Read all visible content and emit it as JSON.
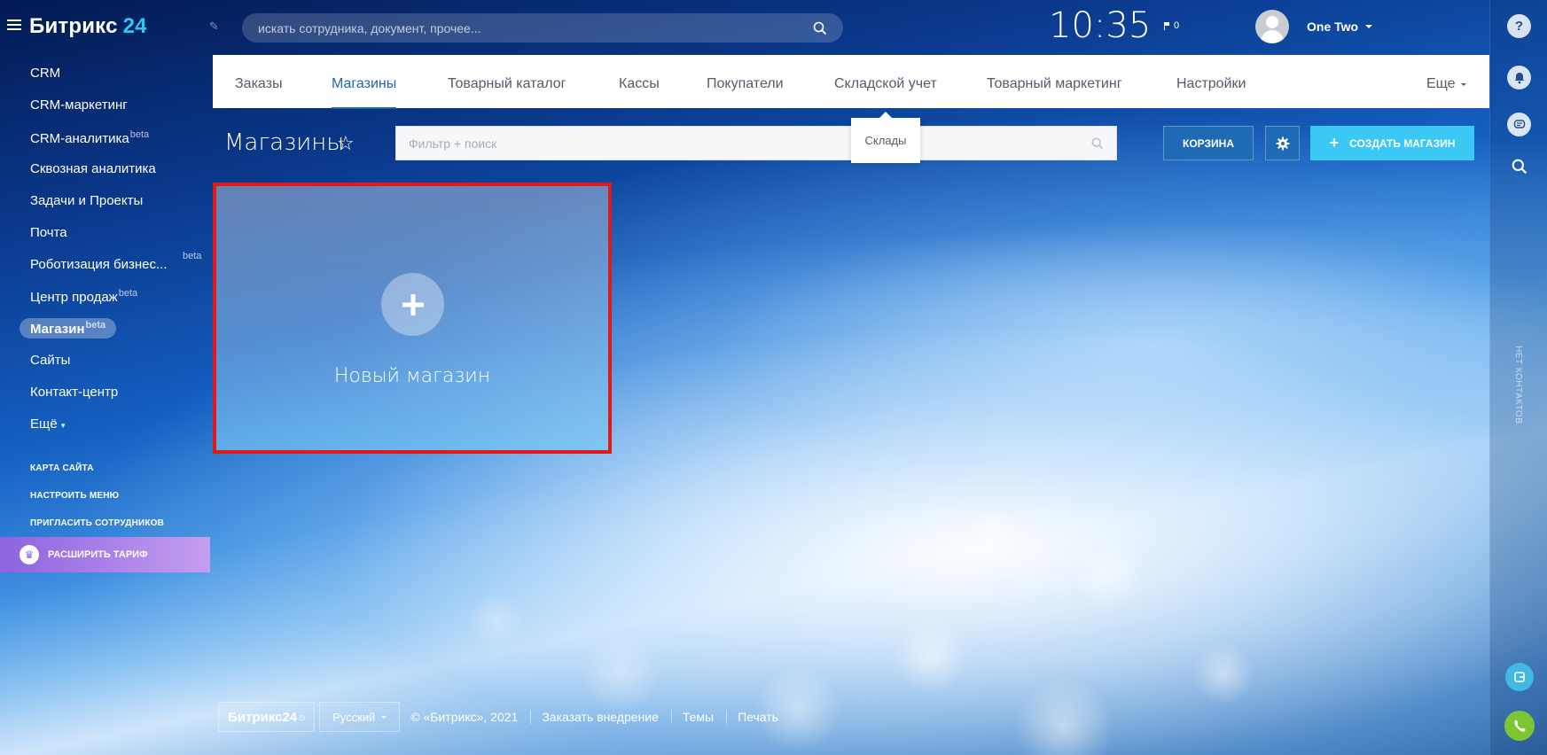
{
  "header": {
    "logo_text": "Битрикс",
    "logo_num": "24",
    "search_placeholder": "искать сотрудника, документ, прочее...",
    "clock": "10:35",
    "flag_count": "0",
    "user_name": "One Two"
  },
  "sidebar": {
    "items": [
      {
        "label": "CRM",
        "badge": ""
      },
      {
        "label": "CRM-маркетинг",
        "badge": ""
      },
      {
        "label": "CRM-аналитика",
        "badge": "beta"
      },
      {
        "label": "Сквозная аналитика",
        "badge": ""
      },
      {
        "label": "Задачи и Проекты",
        "badge": ""
      },
      {
        "label": "Почта",
        "badge": ""
      },
      {
        "label": "Роботизация бизнес...",
        "badge": "beta"
      },
      {
        "label": "Центр продаж",
        "badge": "beta"
      },
      {
        "label": "Магазин",
        "badge": "beta"
      },
      {
        "label": "Сайты",
        "badge": ""
      },
      {
        "label": "Контакт-центр",
        "badge": ""
      },
      {
        "label": "Ещё",
        "badge": ""
      }
    ],
    "links": [
      "КАРТА САЙТА",
      "НАСТРОИТЬ МЕНЮ",
      "ПРИГЛАСИТЬ СОТРУДНИКОВ"
    ],
    "upgrade_label": "РАСШИРИТЬ ТАРИФ"
  },
  "tabs": {
    "items": [
      "Заказы",
      "Магазины",
      "Товарный каталог",
      "Кассы",
      "Покупатели",
      "Складской учет",
      "Товарный маркетинг",
      "Настройки"
    ],
    "active": "Магазины",
    "more_label": "Еще",
    "popup_label": "Склады"
  },
  "toolbar": {
    "page_title": "Магазины",
    "filter_placeholder": "Фильтр + поиск",
    "basket_label": "КОРЗИНА",
    "create_label": "СОЗДАТЬ МАГАЗИН"
  },
  "card": {
    "label": "Новый магазин"
  },
  "rail": {
    "vertical_text": "НЕТ КОНТАКТОВ"
  },
  "footer": {
    "logo": "Битрикс24",
    "language": "Русский",
    "copyright": "© «Битрикс», 2021",
    "links": [
      "Заказать внедрение",
      "Темы",
      "Печать"
    ]
  },
  "colors": {
    "accent": "#2067b0",
    "create_button": "#3bc8f5",
    "card_highlight": "#e0191a",
    "upgrade": "#8f63e0"
  }
}
